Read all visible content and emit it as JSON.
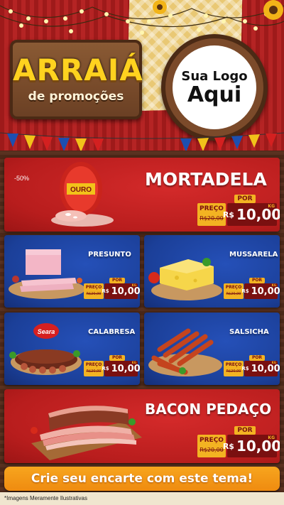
{
  "header": {
    "title": "ARRAIÁ",
    "subtitle": "de promoções",
    "logo_line1": "Sua Logo",
    "logo_line2": "Aqui"
  },
  "currency": "R$",
  "tag_labels": {
    "por": "POR",
    "preco": "PREÇO",
    "kg": "KG"
  },
  "products": [
    {
      "name": "MORTADELA",
      "badge": "-50%",
      "old_price": "R$20,00",
      "price": "10,00",
      "featured": true
    },
    {
      "name": "PRESUNTO",
      "old_price": "R$20,00",
      "price": "10,00"
    },
    {
      "name": "MUSSARELA",
      "old_price": "R$20,00",
      "price": "10,00"
    },
    {
      "name": "CALABRESA",
      "brand": "Seara",
      "old_price": "R$20,00",
      "price": "10,00"
    },
    {
      "name": "SALSICHA",
      "old_price": "R$20,00",
      "price": "10,00"
    },
    {
      "name": "BACON PEDAÇO",
      "old_price": "R$20,00",
      "price": "10,00",
      "featured": true
    }
  ],
  "mortadela_brand": "OURO",
  "cta": "Crie seu encarte com este tema!",
  "disclaimer": "*Imagens Meramente Ilustrativas",
  "colors": {
    "red": "#b81d1d",
    "blue": "#1b3f98",
    "gold": "#f3b322",
    "orange": "#ef8b10"
  }
}
